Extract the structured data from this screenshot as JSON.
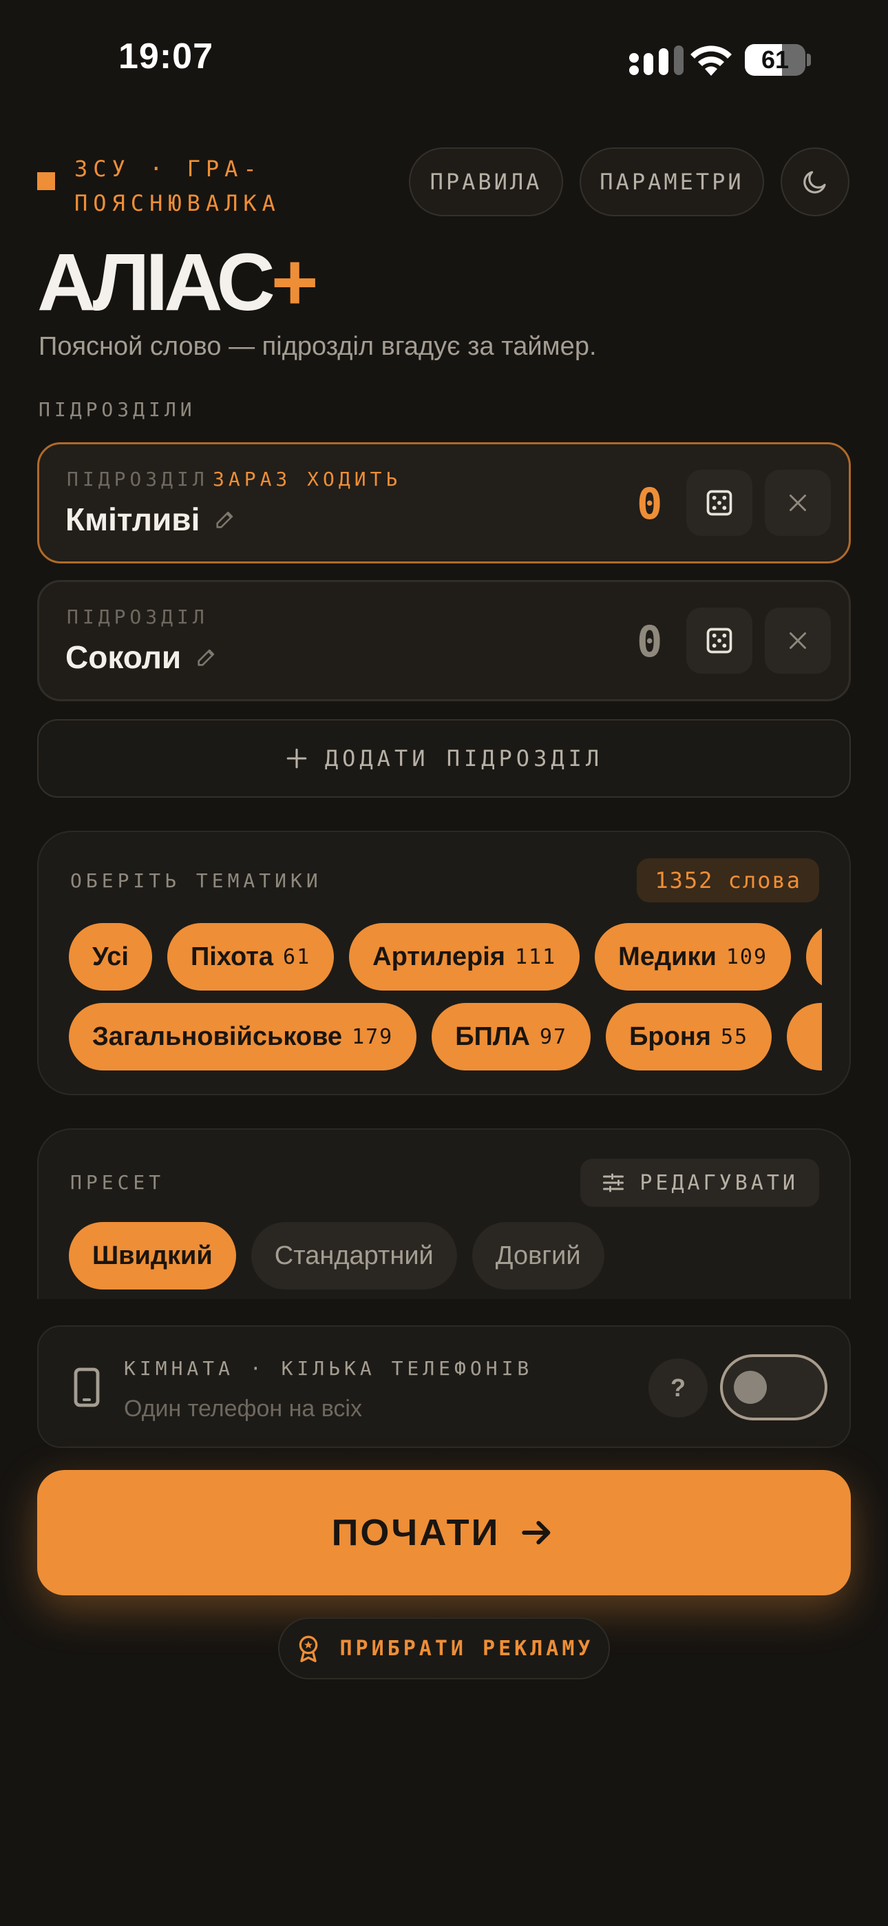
{
  "status_bar": {
    "time": "19:07",
    "battery": "61",
    "battery_level": 0.61
  },
  "header": {
    "brand": "ЗСУ · ГРА-ПОЯСНЮВАЛКА",
    "rules_label": "ПРАВИЛА",
    "params_label": "ПАРАМЕТРИ",
    "title_main": "АЛІАС",
    "title_plus": "+",
    "subtitle": "Поясной слово — підрозділ вгадує за таймер."
  },
  "teams": {
    "section_label": "ПІДРОЗДІЛИ",
    "items": [
      {
        "label": "ПІДРОЗДІЛ",
        "now_label": "ЗАРАЗ ХОДИТЬ",
        "name": "Кмітливі",
        "score": "0"
      },
      {
        "label": "ПІДРОЗДІЛ",
        "name": "Соколи",
        "score": "0"
      }
    ],
    "add_label": "ДОДАТИ ПІДРОЗДІЛ"
  },
  "themes": {
    "section_label": "ОБЕРІТЬ ТЕМАТИКИ",
    "count": "1352 слова",
    "row1": [
      {
        "name": "Усі",
        "count": ""
      },
      {
        "name": "Піхота",
        "count": "61"
      },
      {
        "name": "Артилерія",
        "count": "111"
      },
      {
        "name": "Медики",
        "count": "109"
      }
    ],
    "row2": [
      {
        "name": "Загальновійськове",
        "count": "179"
      },
      {
        "name": "БПЛА",
        "count": "97"
      },
      {
        "name": "Броня",
        "count": "55"
      }
    ]
  },
  "preset": {
    "section_label": "ПРЕСЕТ",
    "edit_label": "РЕДАГУВАТИ",
    "options": [
      "Швидкий",
      "Стандартний",
      "Довгий"
    ],
    "selected": "Швидкий"
  },
  "room": {
    "title": "КІМНАТА · КІЛЬКА ТЕЛЕФОНІВ",
    "subtitle": "Один телефон на всіх",
    "help": "?",
    "enabled": false
  },
  "start_label": "ПОЧАТИ",
  "remove_ads_label": "ПРИБРАТИ РЕКЛАМУ",
  "colors": {
    "accent": "#ee8e37",
    "background": "#161411",
    "card": "#201d19"
  }
}
